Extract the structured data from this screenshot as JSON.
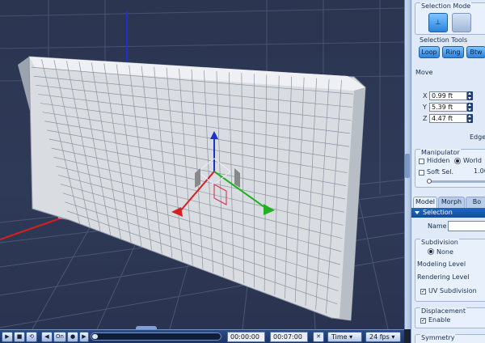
{
  "panel": {
    "selection_mode": {
      "title": "Selection Mode"
    },
    "selection_tools": {
      "title": "Selection Tools",
      "buttons": [
        "Loop",
        "Ring",
        "Btw"
      ]
    },
    "move": {
      "title": "Move",
      "x_label": "X",
      "x_value": "0.99 ft",
      "y_label": "Y",
      "y_value": "5.39 ft",
      "z_label": "Z",
      "z_value": "4.47 ft",
      "edge_label": "Edge"
    },
    "manipulator": {
      "title": "Manipulator",
      "hidden_label": "Hidden",
      "world_label": "World",
      "soft_sel_label": "Soft Sel.",
      "soft_sel_value": "1.00"
    },
    "tabs": [
      "Model",
      "Morph",
      "Bo"
    ],
    "selection_section": "Selection",
    "name_label": "Name",
    "name_value": "",
    "subdivision": {
      "title": "Subdivision",
      "none_label": "None",
      "modeling_level_label": "Modeling Level",
      "rendering_level_label": "Rendering Level",
      "uv_subdivision_label": "UV Subdivision",
      "uv_subdivision_checked": true
    },
    "displacement": {
      "title": "Displacement",
      "enable_label": "Enable",
      "enable_checked": true
    },
    "symmetry": {
      "title": "Symmetry"
    }
  },
  "timeline": {
    "current_time": "00:00:00",
    "end_time": "00:07:00",
    "time_unit": "Time",
    "fps": "24 fps",
    "on_label": "On"
  },
  "colors": {
    "axis_x": "#d62020",
    "axis_y": "#20b020",
    "axis_z": "#1f2fd0",
    "accent_button": "#2b83dc",
    "viewport_bg": "#2f3a58"
  }
}
